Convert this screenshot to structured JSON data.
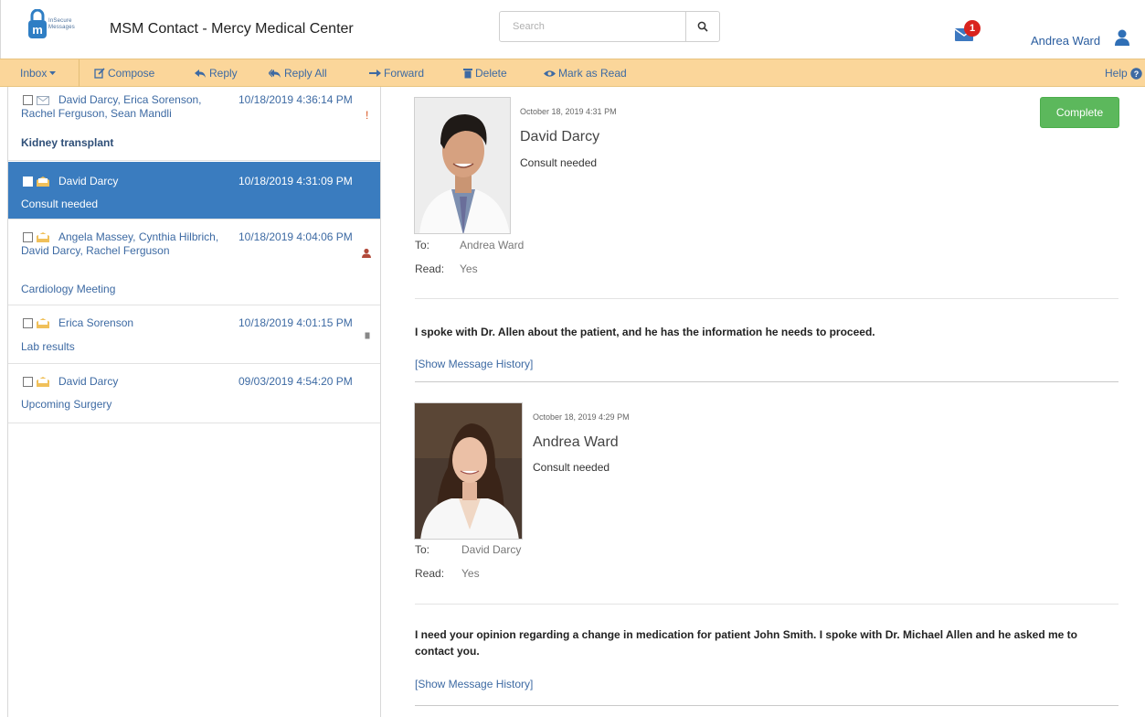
{
  "header": {
    "logo_text": [
      "InSecure",
      "Messages"
    ],
    "title": "MSM Contact - Mercy Medical Center",
    "search_placeholder": "Search",
    "notification_count": "1",
    "user_name": "Andrea Ward"
  },
  "toolbar": {
    "inbox": "Inbox",
    "compose": "Compose",
    "reply": "Reply",
    "reply_all": "Reply All",
    "forward": "Forward",
    "delete": "Delete",
    "mark_read": "Mark as Read",
    "help": "Help"
  },
  "messages": [
    {
      "senders": "David Darcy, Erica Sorenson, Rachel Ferguson, Sean Mandli",
      "date": "10/18/2019 4:36:14 PM",
      "subject": "Kidney transplant",
      "flag": "!"
    },
    {
      "senders": "David Darcy",
      "date": "10/18/2019 4:31:09 PM",
      "subject": "Consult needed",
      "flag": ""
    },
    {
      "senders": "Angela Massey, Cynthia Hilbrich, David Darcy, Rachel Ferguson",
      "date": "10/18/2019 4:04:06 PM",
      "subject": "Cardiology Meeting",
      "flag": ""
    },
    {
      "senders": "Erica Sorenson",
      "date": "10/18/2019 4:01:15 PM",
      "subject": "Lab results",
      "flag": ""
    },
    {
      "senders": "David Darcy",
      "date": "09/03/2019 4:54:20 PM",
      "subject": "Upcoming Surgery",
      "flag": ""
    }
  ],
  "thread": {
    "complete_label": "Complete",
    "to_label": "To:",
    "read_label": "Read:",
    "history_label": "[Show Message History]",
    "items": [
      {
        "date": "October 18, 2019 4:31 PM",
        "sender": "David Darcy",
        "subject": "Consult needed",
        "to": "Andrea Ward",
        "read": "Yes",
        "body": "I spoke with Dr. Allen about the patient, and he has the information he needs to proceed."
      },
      {
        "date": "October 18, 2019 4:29 PM",
        "sender": "Andrea Ward",
        "subject": "Consult needed",
        "to": "David Darcy",
        "read": "Yes",
        "body": "I need your opinion regarding a change in medication for patient John Smith. I spoke with Dr. Michael Allen and he asked me to contact you."
      }
    ]
  },
  "colors": {
    "toolbar_bg": "#fbd69a",
    "link_blue": "#3d6aa3",
    "selected_row": "#3a7cbf",
    "complete_green": "#5cb85c",
    "badge_red": "#d9231e"
  }
}
